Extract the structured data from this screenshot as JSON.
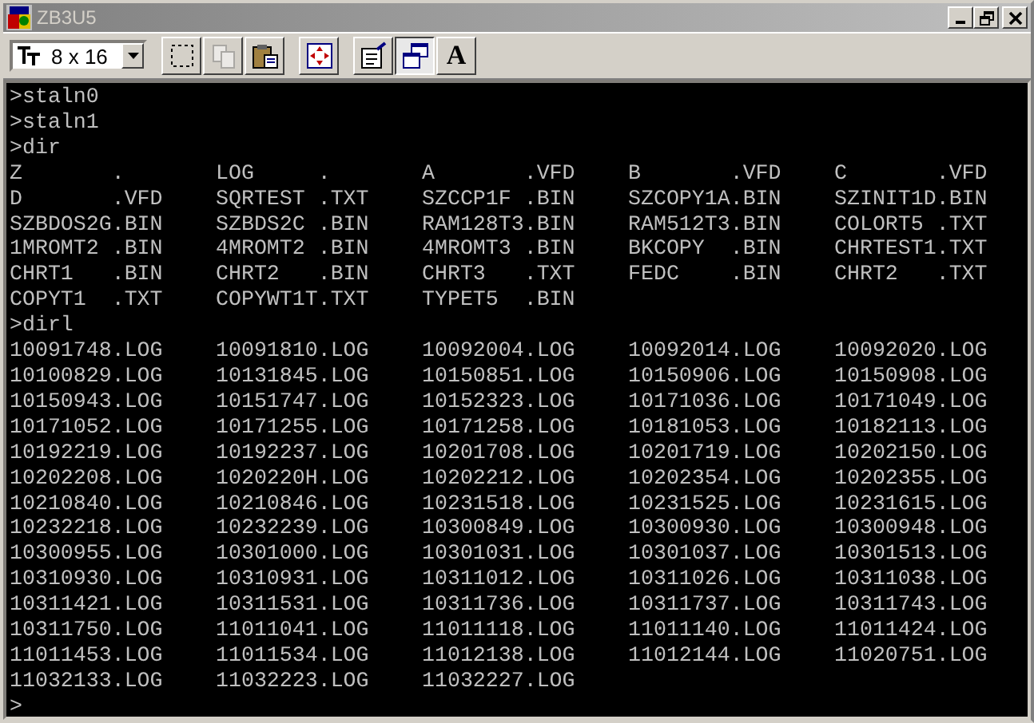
{
  "window": {
    "title": "ZB3U5",
    "active": false
  },
  "toolbar": {
    "font_size": "8 x 16",
    "buttons": [
      {
        "kind": "mark",
        "disabled": false,
        "pressed": false
      },
      {
        "kind": "copy",
        "disabled": true,
        "pressed": false
      },
      {
        "kind": "paste",
        "disabled": false,
        "pressed": false
      },
      {
        "kind": "fullscreen",
        "disabled": false,
        "pressed": false
      },
      {
        "kind": "properties",
        "disabled": false,
        "pressed": false
      },
      {
        "kind": "background",
        "disabled": false,
        "pressed": true
      },
      {
        "kind": "font",
        "label": "A",
        "disabled": false,
        "pressed": false
      }
    ]
  },
  "console": {
    "lines": [
      {
        "kind": "command",
        "text": ">staln0"
      },
      {
        "kind": "command",
        "text": ">staln1"
      },
      {
        "kind": "command",
        "text": ">dir"
      },
      {
        "kind": "entries",
        "cells": [
          "Z       .",
          "LOG     .",
          "A       .VFD",
          "B       .VFD",
          "C       .VFD"
        ]
      },
      {
        "kind": "entries",
        "cells": [
          "D       .VFD",
          "SQRTEST .TXT",
          "SZCCP1F .BIN",
          "SZCOPY1A.BIN",
          "SZINIT1D.BIN"
        ]
      },
      {
        "kind": "entries",
        "cells": [
          "SZBDOS2G.BIN",
          "SZBDS2C .BIN",
          "RAM128T3.BIN",
          "RAM512T3.BIN",
          "COLORT5 .TXT"
        ]
      },
      {
        "kind": "entries",
        "cells": [
          "1MROMT2 .BIN",
          "4MROMT2 .BIN",
          "4MROMT3 .BIN",
          "BKCOPY  .BIN",
          "CHRTEST1.TXT"
        ]
      },
      {
        "kind": "entries",
        "cells": [
          "CHRT1   .BIN",
          "CHRT2   .BIN",
          "CHRT3   .TXT",
          "FEDC    .BIN",
          "CHRT2   .TXT"
        ]
      },
      {
        "kind": "entries",
        "cells": [
          "COPYT1  .TXT",
          "COPYWT1T.TXT",
          "TYPET5  .BIN"
        ]
      },
      {
        "kind": "command",
        "text": ">dirl"
      },
      {
        "kind": "entries",
        "cells": [
          "10091748.LOG",
          "10091810.LOG",
          "10092004.LOG",
          "10092014.LOG",
          "10092020.LOG"
        ]
      },
      {
        "kind": "entries",
        "cells": [
          "10100829.LOG",
          "10131845.LOG",
          "10150851.LOG",
          "10150906.LOG",
          "10150908.LOG"
        ]
      },
      {
        "kind": "entries",
        "cells": [
          "10150943.LOG",
          "10151747.LOG",
          "10152323.LOG",
          "10171036.LOG",
          "10171049.LOG"
        ]
      },
      {
        "kind": "entries",
        "cells": [
          "10171052.LOG",
          "10171255.LOG",
          "10171258.LOG",
          "10181053.LOG",
          "10182113.LOG"
        ]
      },
      {
        "kind": "entries",
        "cells": [
          "10192219.LOG",
          "10192237.LOG",
          "10201708.LOG",
          "10201719.LOG",
          "10202150.LOG"
        ]
      },
      {
        "kind": "entries",
        "cells": [
          "10202208.LOG",
          "1020220H.LOG",
          "10202212.LOG",
          "10202354.LOG",
          "10202355.LOG"
        ]
      },
      {
        "kind": "entries",
        "cells": [
          "10210840.LOG",
          "10210846.LOG",
          "10231518.LOG",
          "10231525.LOG",
          "10231615.LOG"
        ]
      },
      {
        "kind": "entries",
        "cells": [
          "10232218.LOG",
          "10232239.LOG",
          "10300849.LOG",
          "10300930.LOG",
          "10300948.LOG"
        ]
      },
      {
        "kind": "entries",
        "cells": [
          "10300955.LOG",
          "10301000.LOG",
          "10301031.LOG",
          "10301037.LOG",
          "10301513.LOG"
        ]
      },
      {
        "kind": "entries",
        "cells": [
          "10310930.LOG",
          "10310931.LOG",
          "10311012.LOG",
          "10311026.LOG",
          "10311038.LOG"
        ]
      },
      {
        "kind": "entries",
        "cells": [
          "10311421.LOG",
          "10311531.LOG",
          "10311736.LOG",
          "10311737.LOG",
          "10311743.LOG"
        ]
      },
      {
        "kind": "entries",
        "cells": [
          "10311750.LOG",
          "11011041.LOG",
          "11011118.LOG",
          "11011140.LOG",
          "11011424.LOG"
        ]
      },
      {
        "kind": "entries",
        "cells": [
          "11011453.LOG",
          "11011534.LOG",
          "11012138.LOG",
          "11012144.LOG",
          "11020751.LOG"
        ]
      },
      {
        "kind": "entries",
        "cells": [
          "11032133.LOG",
          "11032223.LOG",
          "11032227.LOG"
        ]
      },
      {
        "kind": "command",
        "text": ">"
      }
    ]
  }
}
